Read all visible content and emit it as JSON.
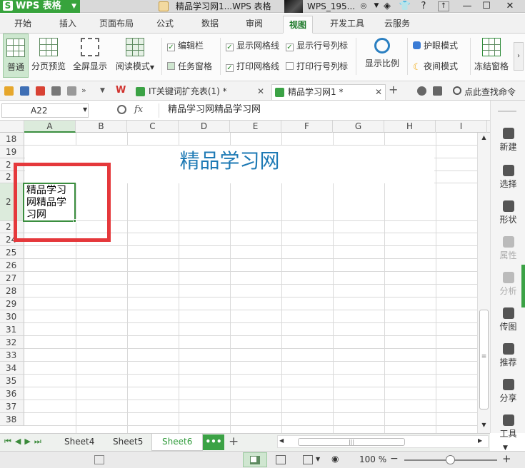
{
  "app": {
    "name": "WPS 表格",
    "logo_letter": "S"
  },
  "titlebar": {
    "doc_title": "精品学习网1...WPS 表格",
    "user": "WPS_195..."
  },
  "tabs": [
    {
      "label": "开始"
    },
    {
      "label": "插入"
    },
    {
      "label": "页面布局"
    },
    {
      "label": "公式"
    },
    {
      "label": "数据"
    },
    {
      "label": "审阅"
    },
    {
      "label": "视图",
      "active": true
    },
    {
      "label": "开发工具"
    },
    {
      "label": "云服务"
    }
  ],
  "ribbon": {
    "normal": "普通",
    "page_break": "分页预览",
    "full_screen": "全屏显示",
    "reading_mode": "阅读模式",
    "checks": [
      {
        "label": "编辑栏",
        "checked": true
      },
      {
        "label": "任务窗格",
        "checked": false
      },
      {
        "label": "显示网格线",
        "checked": true
      },
      {
        "label": "打印网格线",
        "checked": true
      },
      {
        "label": "显示行号列标",
        "checked": true
      },
      {
        "label": "打印行号列标",
        "checked": false
      }
    ],
    "zoom": "显示比例",
    "eye_mode": "护眼模式",
    "night_mode": "夜间模式",
    "freeze": "冻结窗格"
  },
  "doc_tabs": [
    {
      "label": "IT关键词扩充表(1) *"
    },
    {
      "label": "精品学习网1 *",
      "active": true
    }
  ],
  "find_command": "点此查找命令",
  "formula_bar": {
    "name_box": "A22",
    "fx": "fx",
    "content": "精品学习网精品学习网"
  },
  "columns": [
    "A",
    "B",
    "C",
    "D",
    "E",
    "F",
    "G",
    "H",
    "I"
  ],
  "rows": [
    "18",
    "19",
    "2",
    "2",
    "2",
    "2",
    "24",
    "25",
    "26",
    "27",
    "28",
    "29",
    "30",
    "31",
    "32",
    "33",
    "34",
    "35",
    "36",
    "37",
    "38"
  ],
  "sheet": {
    "title": "精品学习网",
    "cell_a22": "精品学习网精品学习网",
    "accent": "#1e7ab5"
  },
  "right_panel": [
    {
      "label": "新建",
      "icon": "new-icon"
    },
    {
      "label": "选择",
      "icon": "select-icon"
    },
    {
      "label": "形状",
      "icon": "shape-icon"
    },
    {
      "label": "属性",
      "icon": "property-icon",
      "disabled": true
    },
    {
      "label": "分析",
      "icon": "analysis-icon",
      "disabled": true
    },
    {
      "label": "传图",
      "icon": "image-icon"
    },
    {
      "label": "推荐",
      "icon": "recommend-icon"
    },
    {
      "label": "分享",
      "icon": "share-icon"
    },
    {
      "label": "工具",
      "icon": "toolbox-icon"
    }
  ],
  "sheet_tabs": [
    {
      "label": "Sheet4"
    },
    {
      "label": "Sheet5"
    },
    {
      "label": "Sheet6",
      "active": true
    }
  ],
  "status": {
    "zoom": "100 %"
  },
  "colors": {
    "brand": "#37a33c",
    "highlight_box": "#e5383b",
    "selection": "#3b8e3f"
  }
}
